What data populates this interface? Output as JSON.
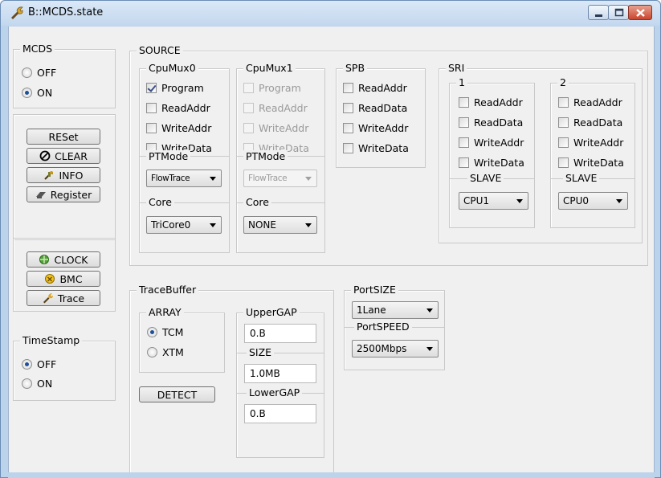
{
  "window": {
    "title": "B::MCDS.state"
  },
  "mcds": {
    "legend": "MCDS",
    "options": [
      "OFF",
      "ON"
    ],
    "selected": "ON"
  },
  "actions": {
    "reset": "RESet",
    "clear": "CLEAR",
    "info": "INFO",
    "register": "Register",
    "clock": "CLOCK",
    "bmc": "BMC",
    "trace": "Trace"
  },
  "timestamp": {
    "legend": "TimeStamp",
    "options": [
      "OFF",
      "ON"
    ],
    "selected": "OFF"
  },
  "source": {
    "legend": "SOURCE",
    "cpumux0": {
      "legend": "CpuMux0",
      "checks": [
        {
          "label": "Program",
          "checked": true
        },
        {
          "label": "ReadAddr",
          "checked": false
        },
        {
          "label": "WriteAddr",
          "checked": false
        },
        {
          "label": "WriteData",
          "checked": false
        }
      ],
      "ptmode_legend": "PTMode",
      "ptmode_value": "FlowTrace",
      "core_legend": "Core",
      "core_value": "TriCore0"
    },
    "cpumux1": {
      "legend": "CpuMux1",
      "checks": [
        {
          "label": "Program",
          "checked": false
        },
        {
          "label": "ReadAddr",
          "checked": false
        },
        {
          "label": "WriteAddr",
          "checked": false
        },
        {
          "label": "WriteData",
          "checked": false
        }
      ],
      "ptmode_legend": "PTMode",
      "ptmode_value": "FlowTrace",
      "core_legend": "Core",
      "core_value": "NONE"
    },
    "spb": {
      "legend": "SPB",
      "checks": [
        "ReadAddr",
        "ReadData",
        "WriteAddr",
        "WriteData"
      ]
    },
    "sri": {
      "legend": "SRI",
      "ports": [
        {
          "legend": "1",
          "checks": [
            "ReadAddr",
            "ReadData",
            "WriteAddr",
            "WriteData"
          ],
          "slave_legend": "SLAVE",
          "slave_value": "CPU1"
        },
        {
          "legend": "2",
          "checks": [
            "ReadAddr",
            "ReadData",
            "WriteAddr",
            "WriteData"
          ],
          "slave_legend": "SLAVE",
          "slave_value": "CPU0"
        }
      ]
    }
  },
  "tracebuffer": {
    "legend": "TraceBuffer",
    "array_legend": "ARRAY",
    "array_options": [
      "TCM",
      "XTM"
    ],
    "array_selected": "TCM",
    "detect": "DETECT",
    "uppergap_legend": "UpperGAP",
    "uppergap_value": "0.B",
    "size_legend": "SIZE",
    "size_value": "1.0MB",
    "lowergap_legend": "LowerGAP",
    "lowergap_value": "0.B"
  },
  "port": {
    "size_legend": "PortSIZE",
    "size_value": "1Lane",
    "speed_legend": "PortSPEED",
    "speed_value": "2500Mbps"
  }
}
